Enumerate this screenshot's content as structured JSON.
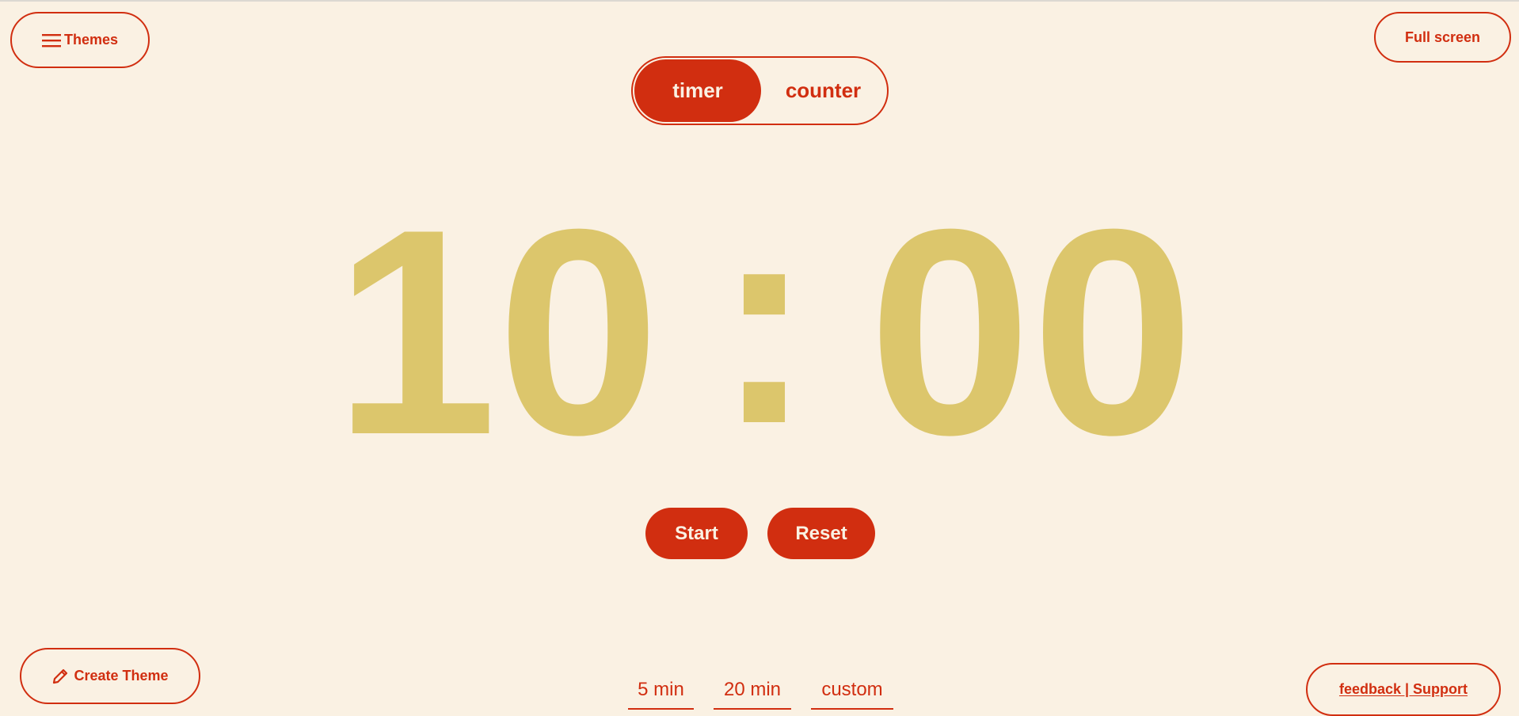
{
  "header": {
    "themes_label": "Themes",
    "fullscreen_label": "Full screen"
  },
  "mode": {
    "timer_label": "timer",
    "counter_label": "counter",
    "active": "timer"
  },
  "clock": {
    "minutes": "10",
    "separator": ":",
    "seconds": "00"
  },
  "controls": {
    "start_label": "Start",
    "reset_label": "Reset"
  },
  "presets": [
    "5 min",
    "20 min",
    "custom"
  ],
  "footer": {
    "create_theme_label": "Create Theme",
    "feedback_label": "feedback | Support"
  },
  "colors": {
    "background": "#faf1e3",
    "accent": "#d12e10",
    "digits": "#dcc66c"
  },
  "icons": {
    "themes": "menu-icon",
    "create_theme": "pencil-icon"
  }
}
